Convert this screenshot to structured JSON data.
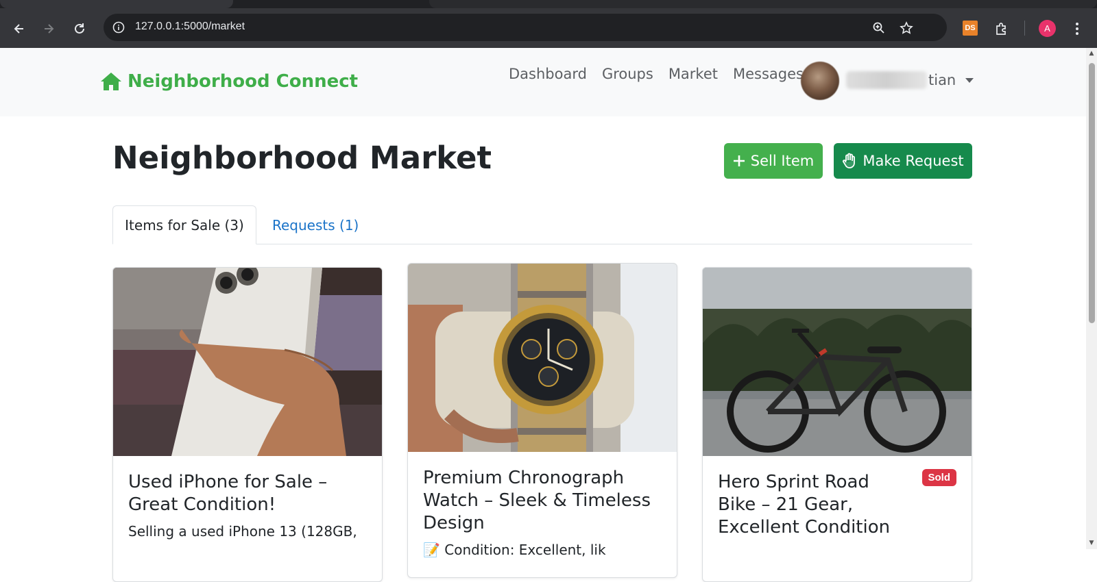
{
  "browser": {
    "url": "127.0.0.1:5000/market",
    "profile_initial": "A",
    "extension_label": "DS"
  },
  "site": {
    "brand": "Neighborhood Connect",
    "nav": [
      "Dashboard",
      "Groups",
      "Market",
      "Messages"
    ],
    "user_name_visible": "tian"
  },
  "page": {
    "title": "Neighborhood Market",
    "sell_button": "Sell Item",
    "request_button": "Make Request",
    "tabs": [
      {
        "label": "Items for Sale (3)",
        "active": true
      },
      {
        "label": "Requests (1)",
        "active": false
      }
    ]
  },
  "listings": [
    {
      "title": "Used iPhone for Sale – Great Condition!",
      "snippet": "Selling a used iPhone 13 (128GB,",
      "sold": false,
      "image": "phone-photo"
    },
    {
      "title": "Premium Chronograph Watch – Sleek & Timeless Design",
      "snippet": "📝 Condition: Excellent, lik",
      "sold": false,
      "image": "watch-photo"
    },
    {
      "title": "Hero Sprint Road Bike – 21 Gear, Excellent Condition",
      "snippet": "",
      "sold": true,
      "badge": "Sold",
      "image": "bike-photo"
    }
  ],
  "colors": {
    "brand_green": "#3fae49",
    "sell_green": "#44b04d",
    "request_green": "#168a4c",
    "tab_link_blue": "#1a73c8",
    "sold_red": "#dc3545"
  }
}
